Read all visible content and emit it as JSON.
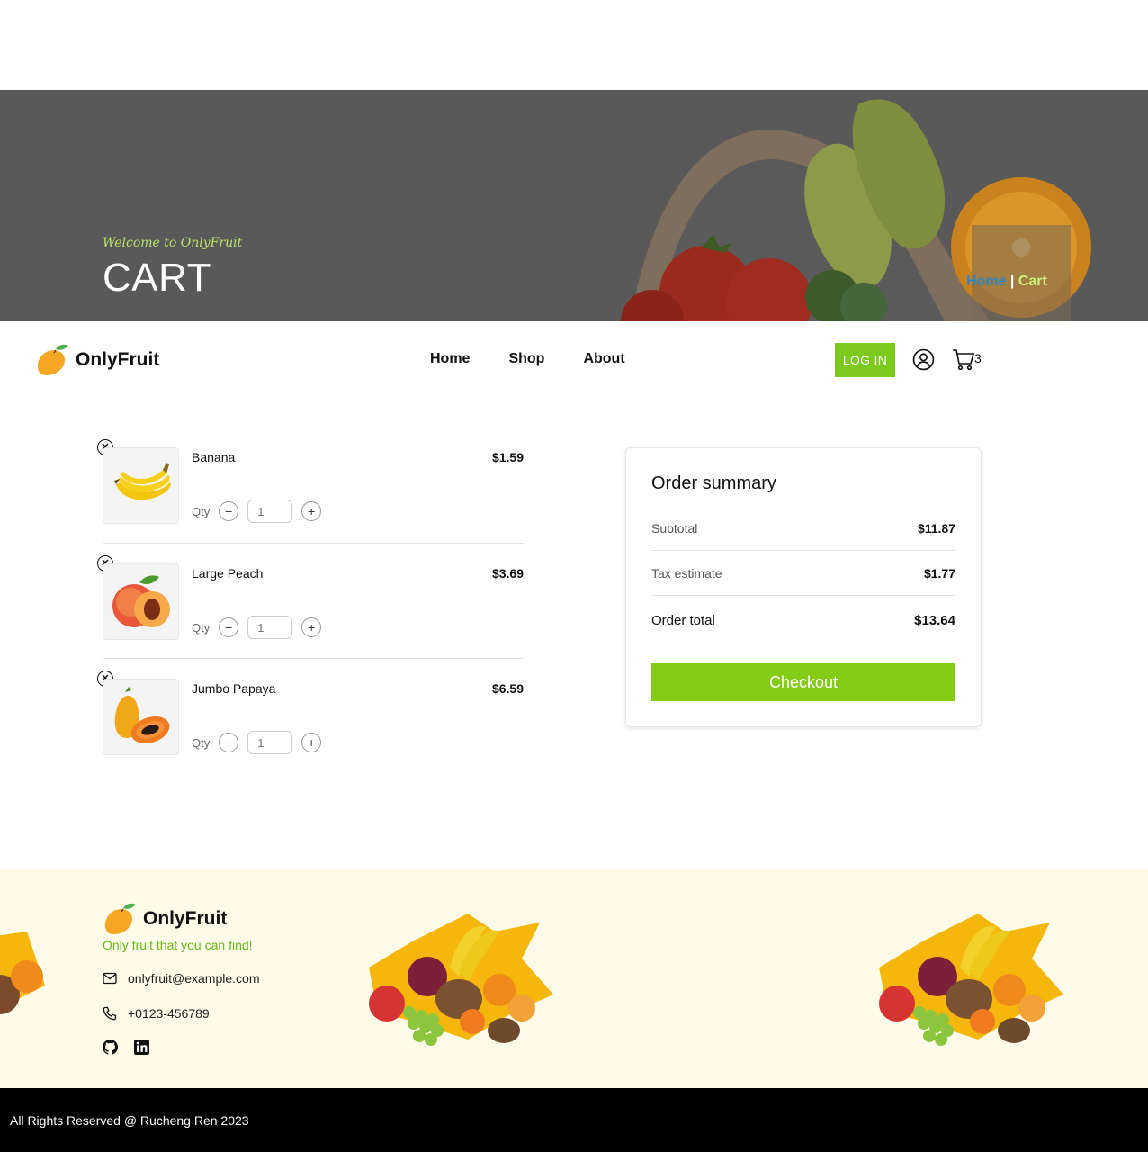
{
  "hero": {
    "tagline": "Welcome to OnlyFruit",
    "title": "CART",
    "breadcrumb_home": "Home",
    "breadcrumb_sep": " | ",
    "breadcrumb_current": "Cart"
  },
  "nav": {
    "brand": "OnlyFruit",
    "links": [
      "Home",
      "Shop",
      "About"
    ],
    "login_label": "LOG IN",
    "cart_count": "3"
  },
  "cart": {
    "qty_label": "Qty",
    "items": [
      {
        "name": "Banana",
        "price": "$1.59",
        "qty": "1",
        "icon": "banana-image"
      },
      {
        "name": "Large Peach",
        "price": "$3.69",
        "qty": "1",
        "icon": "peach-image"
      },
      {
        "name": "Jumbo Papaya",
        "price": "$6.59",
        "qty": "1",
        "icon": "papaya-image"
      }
    ]
  },
  "summary": {
    "title": "Order summary",
    "subtotal_label": "Subtotal",
    "subtotal_value": "$11.87",
    "tax_label": "Tax estimate",
    "tax_value": "$1.77",
    "total_label": "Order total",
    "total_value": "$13.64",
    "checkout_label": "Checkout"
  },
  "footer": {
    "brand": "OnlyFruit",
    "tagline": "Only fruit that you can find!",
    "email": "onlyfruit@example.com",
    "phone": "+0123-456789",
    "social": [
      "github-icon",
      "linkedin-icon"
    ],
    "copyright": "All Rights Reserved @ Rucheng Ren 2023"
  },
  "colors": {
    "accent_green": "#84cc16",
    "hero_overlay": "#5a5a5a",
    "footer_bg": "#fefbe8",
    "breadcrumb_link": "#2e86c1"
  }
}
